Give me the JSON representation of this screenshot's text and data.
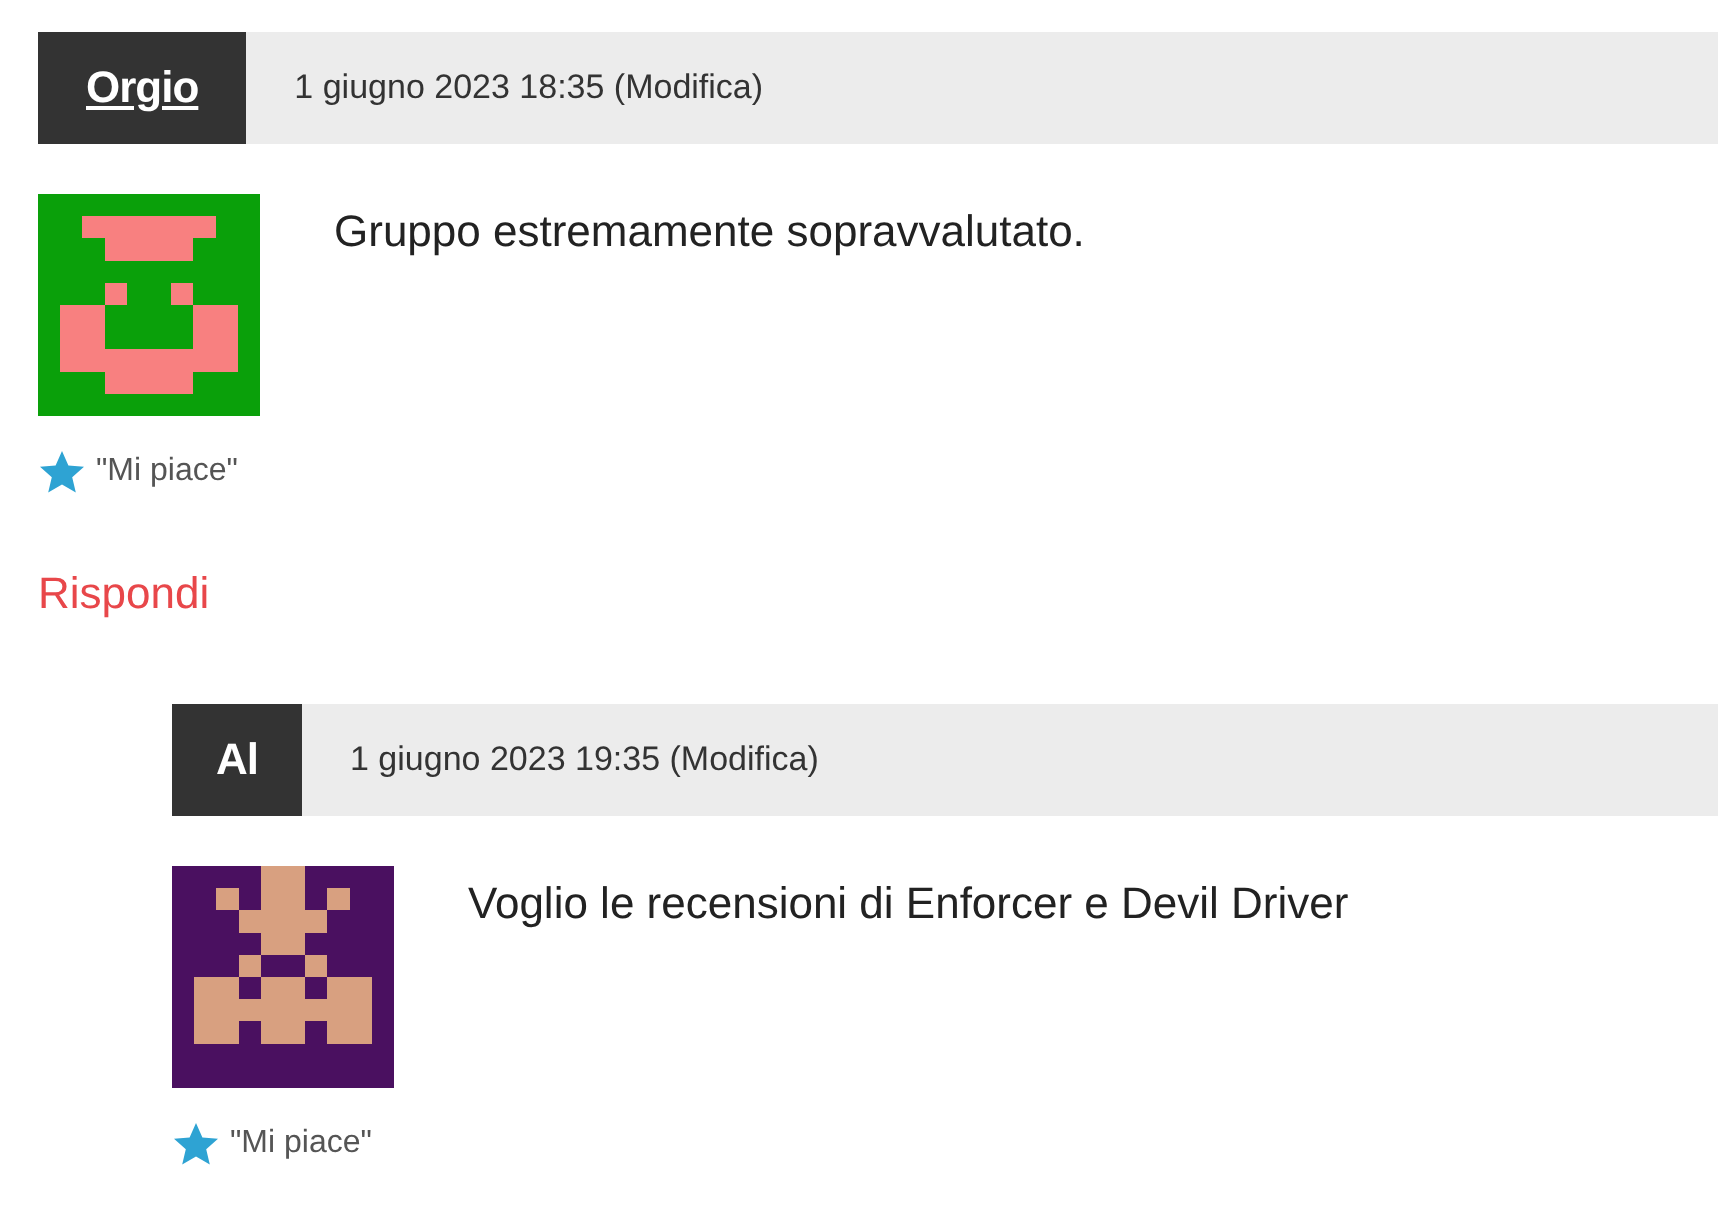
{
  "comments": [
    {
      "author": "Orgio",
      "author_link": true,
      "date": "1 giugno 2023 18:35 (Modifica)",
      "text": "Gruppo estremamente sopravvalutato.",
      "like": "\"Mi piace\"",
      "reply": "Rispondi",
      "children": [
        {
          "author": "Al",
          "author_link": false,
          "date": "1 giugno 2023 19:35 (Modifica)",
          "text": "Voglio le recensioni di Enforcer e Devil Driver",
          "like": "\"Mi piace\""
        }
      ]
    }
  ]
}
